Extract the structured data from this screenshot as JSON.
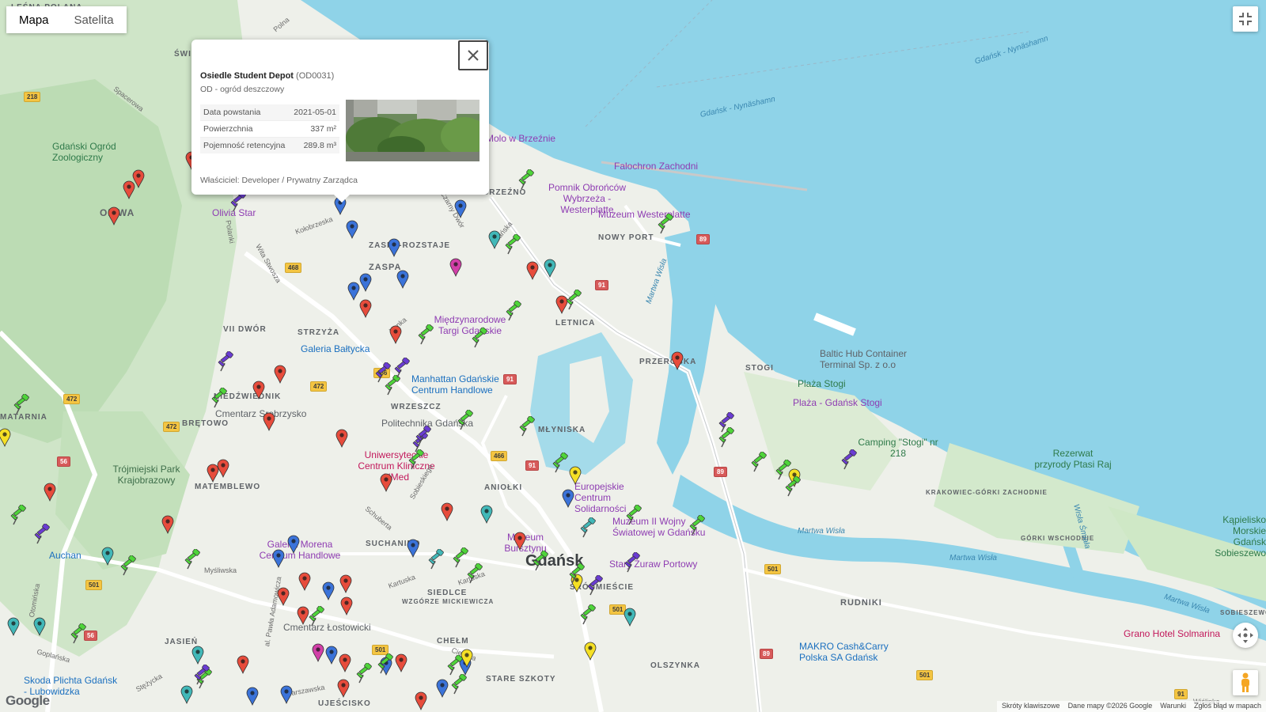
{
  "map_type": {
    "map_label": "Mapa",
    "satellite_label": "Satelita",
    "active": "Mapa"
  },
  "popup": {
    "name": "Osiedle Student Depot",
    "code": "(OD0031)",
    "type": "OD - ogród deszczowy",
    "rows": [
      {
        "label": "Data powstania",
        "value": "2021-05-01"
      },
      {
        "label": "Powierzchnia",
        "value": "337 m²"
      },
      {
        "label": "Pojemność retencyjna",
        "value": "289.8 m³"
      }
    ],
    "owner": "Właściciel: Developer / Prywatny Zarządca"
  },
  "labels": {
    "gdansk": "Gdańsk",
    "oliwa": "OLIWA",
    "zaspa": "ZASPA",
    "zaspa_rozstaje": "ZASPA-ROZSTAJE",
    "brzezno": "BRZEŹNO",
    "nowy_port": "NOWY PORT",
    "letnica": "LETNICA",
    "przerobka": "PRZERÓBKA",
    "stogi": "STOGI",
    "strzyza": "STRZYŻA",
    "wrzeszcz": "WRZESZCZ",
    "siedlce": "SIEDLCE",
    "suchanino": "SUCHANINO",
    "matarnia": "MATARNIA",
    "matemblewo": "MATEMBLEWO",
    "bretowo": "BRĘTOWO",
    "niedzwiednik": "NIEDŹWIEDNIK",
    "mlyniska": "MŁYNISKA",
    "aniolki": "ANIOŁKI",
    "srodmiescie": "ŚRÓDMIEŚCIE",
    "chelm": "CHEŁM",
    "jasien": "JASIEŃ",
    "olszynka": "OLSZYNKA",
    "rudniki": "RUDNIKI",
    "stare_szkoty": "STARE SZKOTY",
    "ujescisko": "UJEŚCISKO",
    "wzgorze": "WZGÓRZE MICKIEWICZA",
    "vii_dwor": "VII DWÓR",
    "krakowiec": "KRAKOWIEC-GÓRKI ZACHODNIE",
    "gorki_wschodnie": "GÓRKI WSCHODNIE",
    "swibno": "ŚWI",
    "lesna_polana": "LEŚNA POLANA",
    "sobieszewo": "SOBIESZEWO",
    "zoo": "Gdański Ogród Zoologiczny",
    "olivia_star": "Olivia Star",
    "molo": "Molo w Brzeźnie",
    "falochron": "Falochron Zachodni",
    "pomnik": "Pomnik Obrońców Wybrzeża - Westerplatte",
    "muzeum_westerplatte": "Muzeum Westerplatte",
    "mtg": "Międzynarodowe Targi Gdańskie",
    "galeria_baltycka": "Galeria Bałtycka",
    "manhattan": "Manhattan Gdańskie Centrum Handlowe",
    "politechnika": "Politechnika Gdańska",
    "cmentarz_srebrzysko": "Cmentarz Srebrzysko",
    "uck": "Uniwersyteckie Centrum Kliniczne UMed",
    "ecs": "Europejskie Centrum Solidarności",
    "muzeum_wojny": "Muzeum II Wojny Światowej w Gdańsku",
    "muzeum_bursztynu": "Muzeum Bursztynu",
    "zuraw": "Stary Żuraw Portowy",
    "galeria_morena": "Galeria Morena Centrum Handlowe",
    "auchan": "Auchan",
    "trojmiejski_park": "Trójmiejski Park Krajobrazowy",
    "cmentarz_lostowicki": "Cmentarz Łostowicki",
    "skoda": "Skoda Plichta Gdańsk - Lubowidzka",
    "makro": "MAKRO Cash&Carry Polska SA Gdańsk",
    "baltic_hub": "Baltic Hub Container Terminal Sp. z o.o",
    "plaza_stogi": "Plaża Stogi",
    "plaza_gdansk_stogi": "Plaża - Gdańsk Stogi",
    "camping": "Camping \"Stogi\" nr 218",
    "rezerwat": "Rezerwat przyrody Ptasi Raj",
    "grano": "Grano Hotel Solmarina",
    "kapielisko": "Kąpielisko Morskie Gdańsk Sobieszewo",
    "martwa_wisla": "Martwa Wisła",
    "martwa_wisla2": "Martwa Wisła",
    "martwa_wisla3": "Martwa Wisła",
    "wisla_smiala": "Wisła Śmiała",
    "nynashamn1": "Gdańsk - Nynäshamn",
    "nynashamn2": "Gdańsk - Nynäshamn",
    "spacerowa": "Spacerowa",
    "polna": "Polna",
    "kolobrzeska": "Kołobrzeska",
    "czarny_dwor": "Czarny Dwór",
    "hynka": "Hynka",
    "wita_stwosza": "Wita Stwosza",
    "grunwaldzka": "Grunwaldzka",
    "sobieskiego": "Sobieskiego",
    "schuberta": "Schuberta",
    "kartuska": "Kartuska",
    "kartuska2": "Kartuska",
    "myslinska": "Myśliwska",
    "pawla_adamowicza": "al. Pawła Adamowicza",
    "warszawska": "Warszawska",
    "cienista": "Cienista",
    "goplanska": "Goplańska",
    "otominska": "Otomińska",
    "stezycka": "Stężycka",
    "polanki": "Polanki",
    "gdanska": "Gdańska",
    "lozka": "Łozka",
    "wielki": "Wiślinka"
  },
  "road_shields": [
    "218",
    "468",
    "472",
    "472",
    "472",
    "466",
    "91",
    "91",
    "91",
    "89",
    "501",
    "501",
    "501",
    "501",
    "501",
    "89",
    "89",
    "56",
    "56",
    "91",
    "466"
  ],
  "footer": {
    "shortcuts": "Skróty klawiszowe",
    "data": "Dane mapy ©2026 Google",
    "terms": "Warunki",
    "report": "Zgłoś błąd w mapach"
  },
  "google": "Google",
  "colors": {
    "water": "#8fd3e8",
    "land": "#eef0ea",
    "forest": "#c9e3c1",
    "pin_red": "#e74c3c",
    "pin_blue": "#3b73d9",
    "pin_teal": "#42b8b8",
    "pin_yellow": "#f5e025",
    "pin_pink": "#d23fa8",
    "pushpin_green": "#4fd43a",
    "pushpin_purple": "#6a3cd2"
  }
}
